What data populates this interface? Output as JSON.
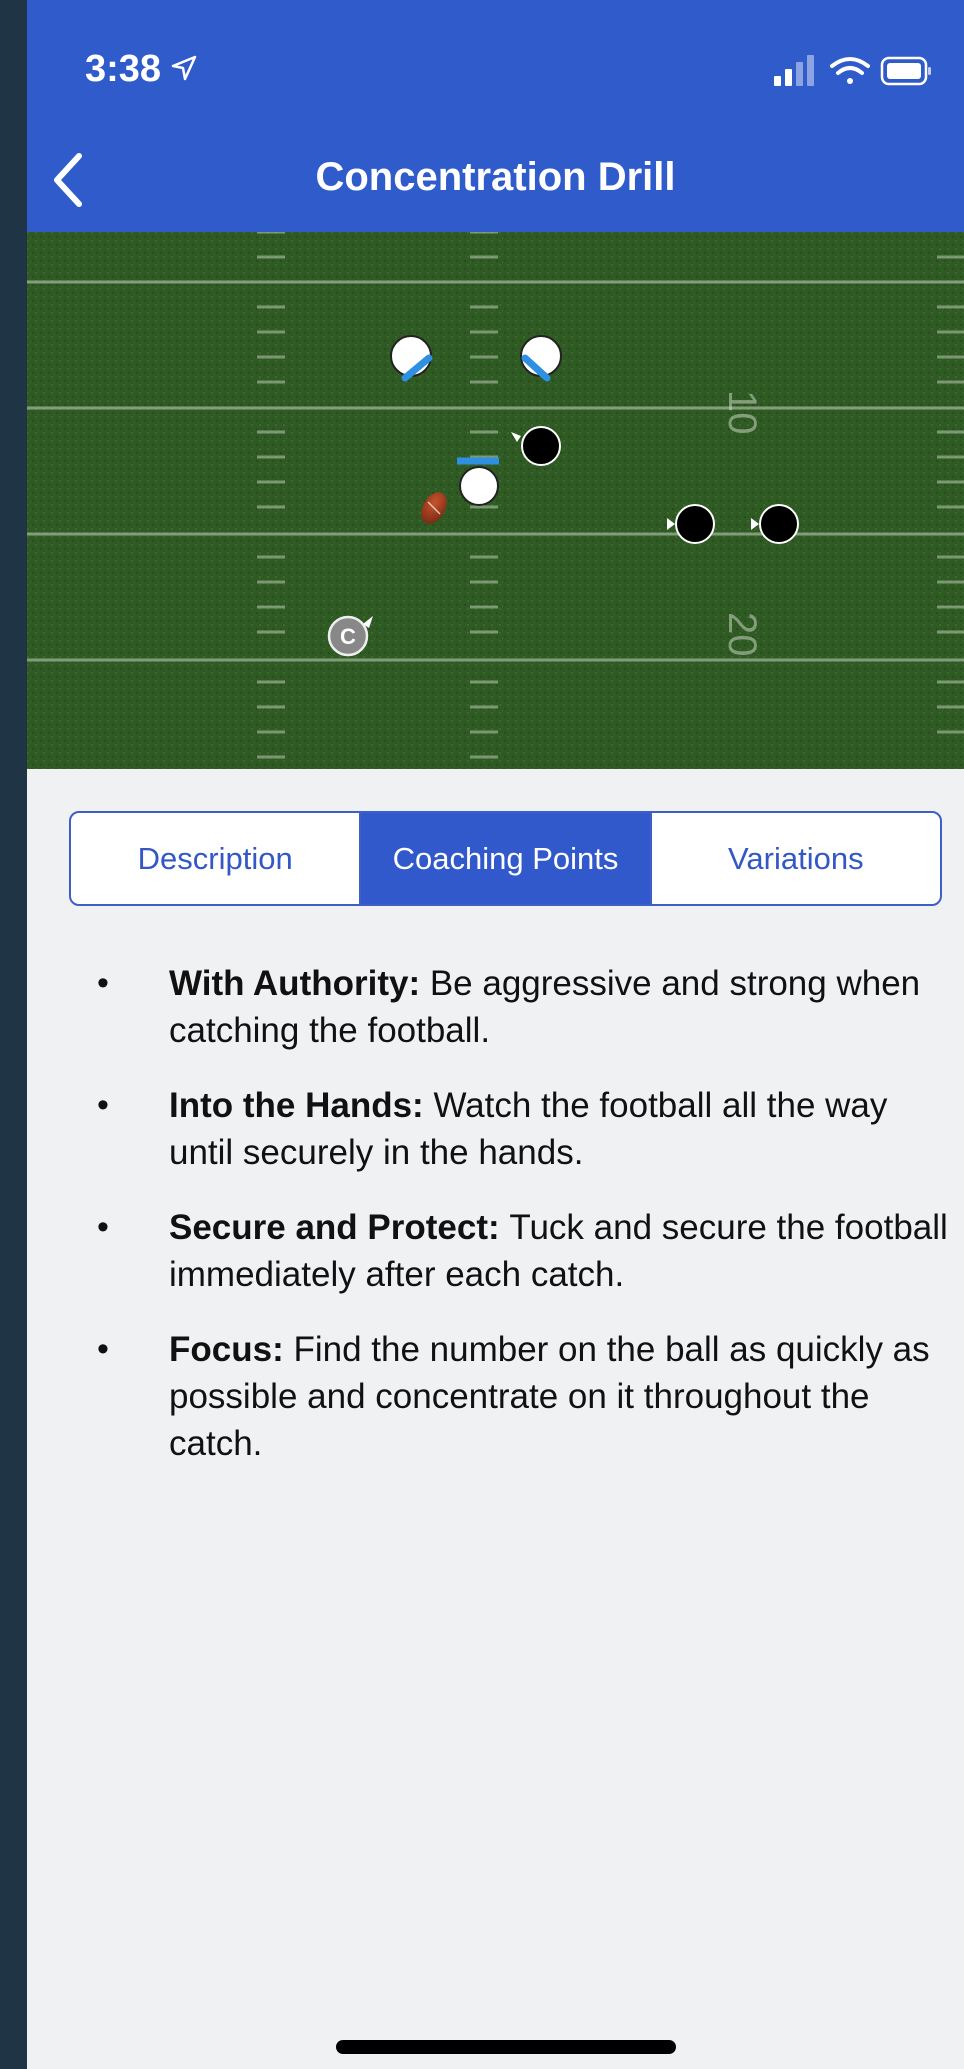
{
  "status_bar": {
    "time": "3:38",
    "location_icon": "location-arrow-icon"
  },
  "header": {
    "title": "Concentration Drill",
    "back_icon": "chevron-left-icon"
  },
  "field": {
    "yard_labels": [
      "10",
      "20"
    ],
    "icons": [
      "offense-player-icon",
      "defense-player-icon",
      "football-icon",
      "coach-icon"
    ],
    "coach_label": "C",
    "colors": {
      "grass": "#2e5623",
      "offense": "#ffffff",
      "defense": "#000000",
      "blocker": "#2f8fe0"
    }
  },
  "tabs": [
    {
      "label": "Description",
      "active": false
    },
    {
      "label": "Coaching Points",
      "active": true
    },
    {
      "label": "Variations",
      "active": false
    }
  ],
  "coaching_points": [
    {
      "title": "With Authority:",
      "text": "Be aggressive and strong when catching the football."
    },
    {
      "title": "Into the Hands:",
      "text": "Watch the football all the way until securely in the hands."
    },
    {
      "title": "Secure and Protect:",
      "text": "Tuck and secure the football immediately after each catch."
    },
    {
      "title": "Focus:",
      "text": "Find the number on the ball as quickly as possible and concentrate on it throughout the catch."
    }
  ],
  "colors": {
    "accent": "#2f5bcb",
    "background": "#f0f1f3"
  }
}
